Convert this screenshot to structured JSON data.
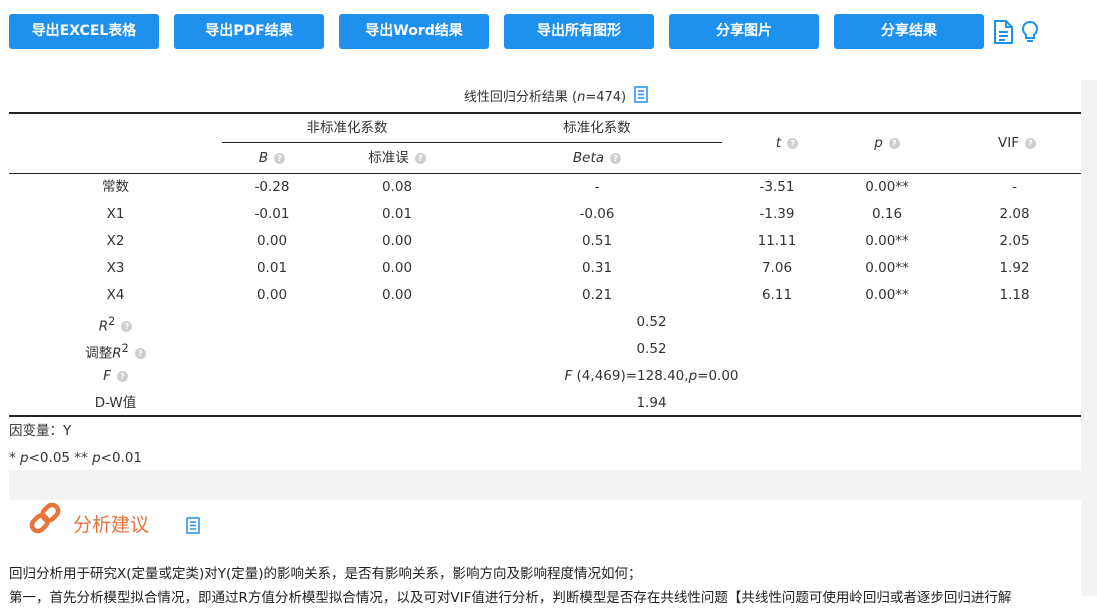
{
  "toolbar": {
    "buttons": [
      {
        "label": "导出EXCEL表格"
      },
      {
        "label": "导出PDF结果"
      },
      {
        "label": "导出Word结果"
      },
      {
        "label": "导出所有图形"
      },
      {
        "label": "分享图片"
      },
      {
        "label": "分享结果"
      }
    ],
    "icons": [
      "document-icon",
      "lightbulb-icon"
    ]
  },
  "table": {
    "caption_prefix": "线性回归分析结果 (",
    "caption_n_symbol": "n",
    "caption_n_value": "=474)",
    "group_headers": {
      "unstd": "非标准化系数",
      "std": "标准化系数"
    },
    "sub_headers": {
      "b": "B",
      "se": "标准误",
      "beta": "Beta",
      "t": "t",
      "p": "p",
      "vif": "VIF"
    },
    "rows": [
      {
        "name": "常数",
        "b": "-0.28",
        "se": "0.08",
        "beta": "-",
        "t": "-3.51",
        "p": "0.00**",
        "vif": "-"
      },
      {
        "name": "X1",
        "b": "-0.01",
        "se": "0.01",
        "beta": "-0.06",
        "t": "-1.39",
        "p": "0.16",
        "vif": "2.08"
      },
      {
        "name": "X2",
        "b": "0.00",
        "se": "0.00",
        "beta": "0.51",
        "t": "11.11",
        "p": "0.00**",
        "vif": "2.05"
      },
      {
        "name": "X3",
        "b": "0.01",
        "se": "0.00",
        "beta": "0.31",
        "t": "7.06",
        "p": "0.00**",
        "vif": "1.92"
      },
      {
        "name": "X4",
        "b": "0.00",
        "se": "0.00",
        "beta": "0.21",
        "t": "6.11",
        "p": "0.00**",
        "vif": "1.18"
      }
    ],
    "stats": {
      "r2_label": "R",
      "r2_sup": "2",
      "r2_value": "0.52",
      "adj_r2_prefix": "调整",
      "adj_r2_label": "R",
      "adj_r2_sup": "2",
      "adj_r2_value": "0.52",
      "f_label": "F",
      "f_value_f": "F",
      "f_value_mid": " (4,469)=128.40,",
      "f_value_p": "p",
      "f_value_end": "=0.00",
      "dw_label": "D-W值",
      "dw_value": "1.94"
    },
    "footnote_dep": "因变量：Y",
    "footnote_sig_1": "* ",
    "footnote_sig_p1": "p",
    "footnote_sig_2": "<0.05 ** ",
    "footnote_sig_p2": "p",
    "footnote_sig_3": "<0.01"
  },
  "advice": {
    "title": "分析建议",
    "line1": "回归分析用于研究X(定量或定类)对Y(定量)的影响关系，是否有影响关系，影响方向及影响程度情况如何；",
    "line2": "第一，首先分析模型拟合情况，即通过R方值分析模型拟合情况，以及可对VIF值进行分析，判断模型是否存在共线性问题【共线性问题可使用岭回归或者逐步回归进行解"
  },
  "colors": {
    "button_bg": "#1e90ee",
    "accent_orange": "#e8743b",
    "icon_blue": "#1e90ee"
  }
}
